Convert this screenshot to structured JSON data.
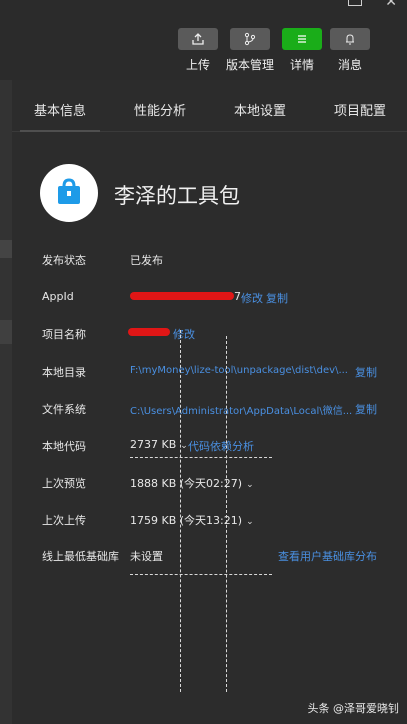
{
  "toolbar": {
    "upload": "上传",
    "version": "版本管理",
    "details": "详情",
    "messages": "消息"
  },
  "tabs": [
    "基本信息",
    "性能分析",
    "本地设置",
    "项目配置"
  ],
  "app": {
    "name": "李泽的工具包"
  },
  "info": {
    "publish_status": {
      "label": "发布状态",
      "value": "已发布"
    },
    "appid": {
      "label": "AppId",
      "visible_suffix": "7",
      "modify": "修改",
      "copy": "复制"
    },
    "project_name": {
      "label": "项目名称",
      "modify": "修改"
    },
    "local_dir": {
      "label": "本地目录",
      "value": "F:\\myMoney\\lize-tool\\unpackage\\dist\\dev\\...",
      "copy": "复制"
    },
    "file_system": {
      "label": "文件系统",
      "value": "C:\\Users\\Administrator\\AppData\\Local\\微信...",
      "copy": "复制"
    },
    "local_code": {
      "label": "本地代码",
      "value": "2737 KB",
      "link": "代码依赖分析"
    },
    "last_preview": {
      "label": "上次预览",
      "value": "1888 KB",
      "time": "(今天02:27)"
    },
    "last_upload": {
      "label": "上次上传",
      "value": "1759 KB",
      "time": "(今天13:21)"
    },
    "min_lib": {
      "label": "线上最低基础库",
      "value": "未设置",
      "link": "查看用户基础库分布"
    }
  },
  "watermark": "头条 @泽哥爱晓钊",
  "colors": {
    "accent_green": "#1aad19",
    "link_blue": "#4a90e2",
    "redaction": "#e01616"
  }
}
